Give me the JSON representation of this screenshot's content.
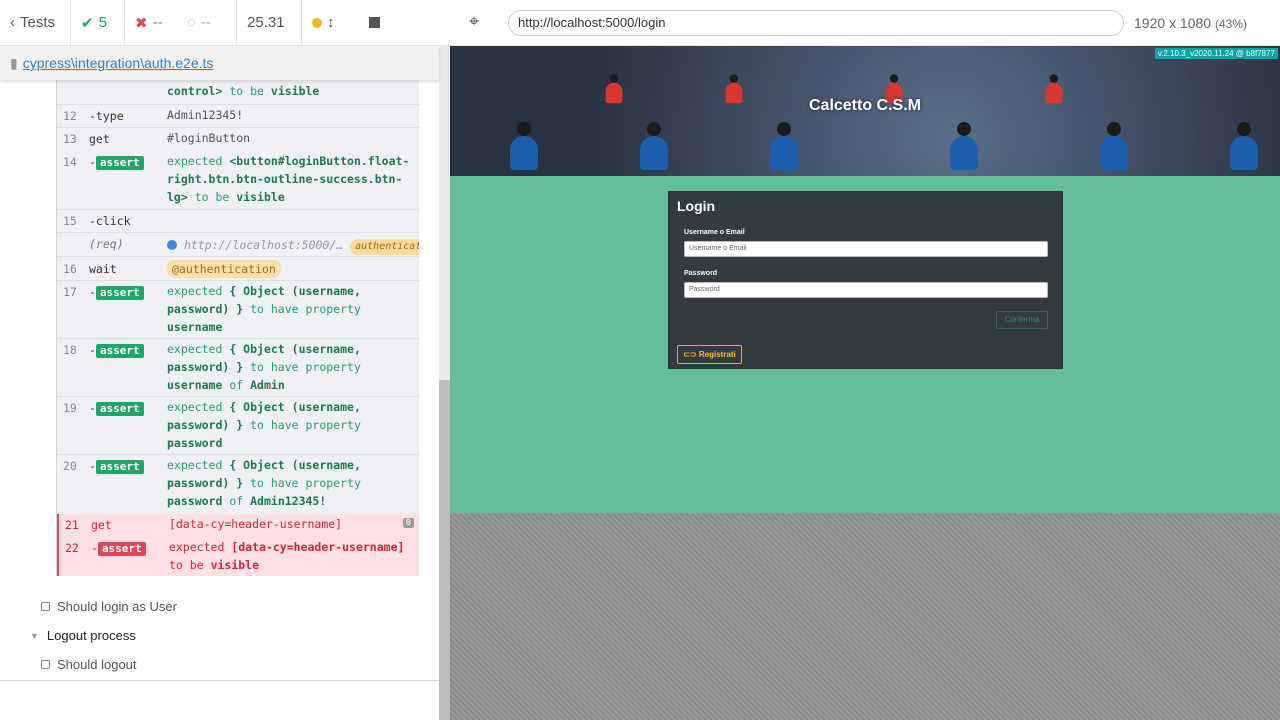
{
  "runner": {
    "back_label": "Tests",
    "passed_count": "5",
    "failed_count": "--",
    "pending_count": "--",
    "duration": "25.31",
    "spec_file": "cypress\\integration\\auth.e2e.ts"
  },
  "commands": [
    {
      "num": "",
      "name": "",
      "msg_a": "control>",
      "msg_b": "to be",
      "msg_c": "visible"
    },
    {
      "num": "12",
      "name": "-type",
      "msg": "Admin12345!"
    },
    {
      "num": "13",
      "name": "get",
      "msg": "#loginButton"
    },
    {
      "num": "14",
      "name": "-",
      "tag": "assert",
      "msg_a": "expected",
      "msg_b": "<button#loginButton.float-right.btn.btn-outline-success.btn-lg>",
      "msg_c": "to be",
      "msg_d": "visible"
    },
    {
      "num": "15",
      "name": "-click"
    },
    {
      "num": "",
      "name": "(req)",
      "msg": "http://localhost:5000/…",
      "pill": "authentication"
    },
    {
      "num": "16",
      "name": "wait",
      "msg": "@authentication"
    },
    {
      "num": "17",
      "name": "-",
      "tag": "assert",
      "msg_a": "expected",
      "msg_b": "{ Object (username, password) }",
      "msg_c": "to have property",
      "msg_d": "username"
    },
    {
      "num": "18",
      "name": "-",
      "tag": "assert",
      "msg_a": "expected",
      "msg_b": "{ Object (username, password) }",
      "msg_c": "to have property",
      "msg_d": "username",
      "msg_e": "of",
      "msg_f": "Admin"
    },
    {
      "num": "19",
      "name": "-",
      "tag": "assert",
      "msg_a": "expected",
      "msg_b": "{ Object (username, password) }",
      "msg_c": "to have property",
      "msg_d": "password"
    },
    {
      "num": "20",
      "name": "-",
      "tag": "assert",
      "msg_a": "expected",
      "msg_b": "{ Object (username, password) }",
      "msg_c": "to have property",
      "msg_d": "password",
      "msg_e": "of",
      "msg_f": "Admin12345!"
    },
    {
      "num": "21",
      "name": "get",
      "msg": "[data-cy=header-username]",
      "badge": "0"
    },
    {
      "num": "22",
      "name": "-",
      "tag": "assert",
      "msg_a": "expected",
      "msg_b": "[data-cy=header-username]",
      "msg_c": "to be",
      "msg_d": "visible"
    }
  ],
  "tests": {
    "login_user": "Should login as User",
    "suite_logout": "Logout process",
    "logout": "Should logout"
  },
  "browser": {
    "url": "http://localhost:5000/login",
    "viewport_size": "1920 x 1080",
    "zoom": "(43%)"
  },
  "app": {
    "version": "v.2.10.3_v2020.11.24 @ b8f7877",
    "title": "Calcetto C.S.M",
    "card_title": "Login",
    "username_label": "Username o Email",
    "username_placeholder": "Username o Email",
    "password_label": "Password",
    "password_placeholder": "Password",
    "confirm_label": "Conferma",
    "register_label": "Registrati"
  },
  "colors": {
    "pass": "#1ea66b",
    "fail": "#e0455a",
    "app_bg": "#61bd9a",
    "card_bg": "#333a41"
  }
}
